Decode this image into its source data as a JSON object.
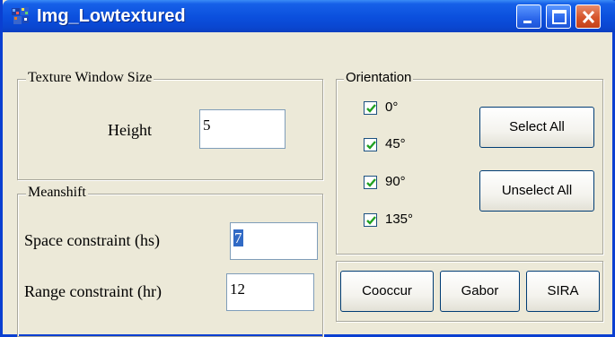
{
  "window": {
    "title": "Img_Lowtextured",
    "icon": "image-app-icon",
    "controls": [
      "minimize-icon",
      "maximize-icon",
      "close-icon"
    ]
  },
  "texture_window": {
    "legend": "Texture Window Size",
    "height_label": "Height",
    "height_value": "5"
  },
  "meanshift": {
    "legend": "Meanshift",
    "space_label": "Space constraint (hs)",
    "space_value": "7",
    "range_label": "Range constraint (hr)",
    "range_value": "12"
  },
  "orientation": {
    "legend": "Orientation",
    "options": [
      {
        "label": "0°",
        "checked": true
      },
      {
        "label": "45°",
        "checked": true
      },
      {
        "label": "90°",
        "checked": true
      },
      {
        "label": "135°",
        "checked": true
      }
    ],
    "select_all_label": "Select All",
    "unselect_all_label": "Unselect All"
  },
  "methods": {
    "cooccur_label": "Cooccur",
    "gabor_label": "Gabor",
    "sira_label": "SIRA"
  },
  "colors": {
    "title_bar": "#0a46d0",
    "window_bg": "#ece9d8",
    "selection": "#316ac5",
    "close_button": "#d6552b"
  }
}
